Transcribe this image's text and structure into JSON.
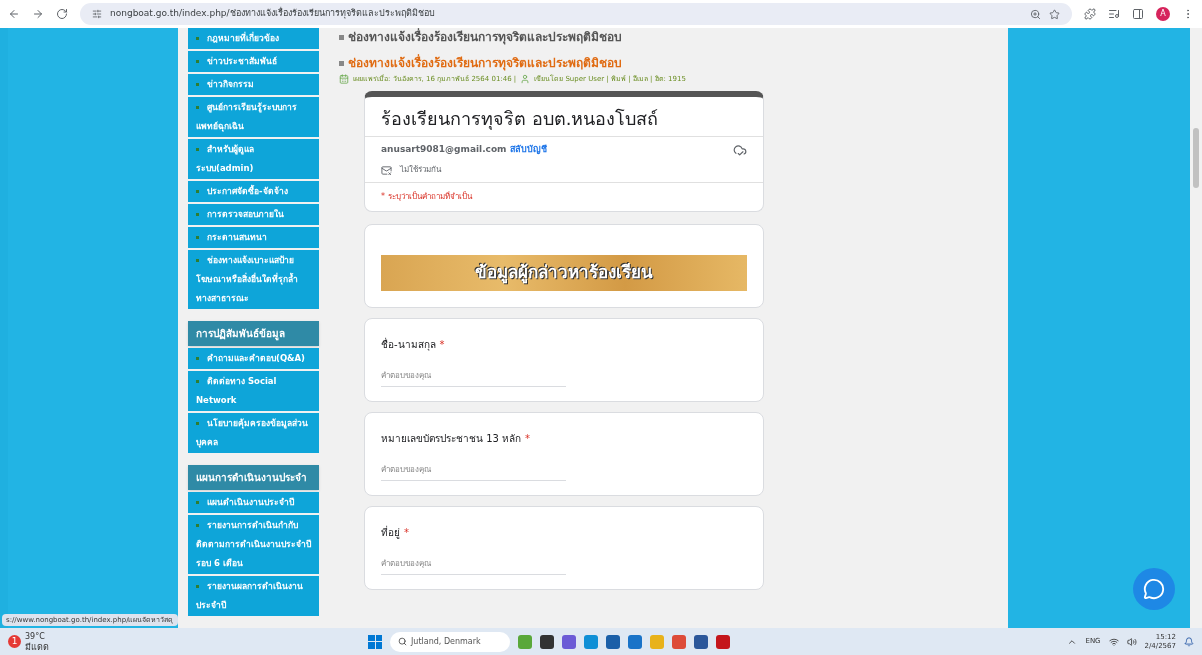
{
  "browser": {
    "url": "nongboat.go.th/index.php/ช่องทางแจ้งเรื่องร้องเรียนการทุจริตและประพฤติมิชอบ",
    "profile": "A"
  },
  "sidebar": {
    "items": [
      {
        "label": "กฎหมายที่เกี่ยวข้อง"
      },
      {
        "label": "ข่าวประชาสัมพันธ์"
      },
      {
        "label": "ข่าวกิจกรรม"
      },
      {
        "label": "ศูนย์การเรียนรู้ระบบการแพทย์ฉุกเฉิน"
      },
      {
        "label": "สำหรับผู้ดูแลระบบ(admin)"
      },
      {
        "label": "ประกาศจัดซื้อ-จัดจ้าง"
      },
      {
        "label": "การตรวจสอบภายใน"
      },
      {
        "label": "กระดานสนทนา"
      },
      {
        "label": "ช่องทางแจ้งเบาะแสป้ายโฆษณาหรือสิ่งอื่นใดที่รุกล้ำทางสาธารณะ"
      }
    ],
    "sections": [
      {
        "heading": "การปฏิสัมพันธ์ข้อมูล",
        "items": [
          {
            "label": "คำถามและคำตอบ(Q&A)"
          },
          {
            "label": "ติดต่อทาง Social Network"
          },
          {
            "label": "นโยบายคุ้มครองข้อมูลส่วนบุคคล"
          }
        ]
      },
      {
        "heading": "แผนการดำเนินงานประจำ",
        "items": [
          {
            "label": "แผนดำเนินงานประจำปี"
          },
          {
            "label": "รายงานการดำเนินกำกับติดตามการดำเนินงานประจำปี รอบ 6 เดือน"
          },
          {
            "label": "รายงานผลการดำเนินงานประจำปี"
          }
        ]
      }
    ]
  },
  "article": {
    "prev_title": "ช่องทางแจ้งเรื่องร้องเรียนการทุจริตและประพฤติมิชอบ",
    "title": "ช่องทางแจ้งเรื่องร้องเรียนการทุจริตและประพฤติมิชอบ",
    "published": "เผยแพร่เมื่อ: วันอังคาร, 16 กุมภาพันธ์ 2564 01:46 |",
    "meta": "เขียนโดย Super User | พิมพ์ | อีเมล | ฮิต: 1915"
  },
  "form": {
    "required_mark": "*",
    "title": "ร้องเรียนการทุจริต อบต.หนองโบสถ์",
    "email": "anusart9081@gmail.com",
    "switch_account": "สลับบัญชี",
    "not_shared": "ไม่ใช้ร่วมกัน",
    "required_note": "* ระบุว่าเป็นคำถามที่จำเป็น",
    "banner": "ข้อมูลผู้กล่าวหาร้องเรียน",
    "questions": [
      {
        "label": "ชื่อ-นามสกุล",
        "required": true,
        "placeholder": "คำตอบของคุณ"
      },
      {
        "label": "หมายเลขบัตรประชาชน 13 หลัก",
        "required": true,
        "placeholder": "คำตอบของคุณ"
      },
      {
        "label": "ที่อยู่",
        "required": true,
        "placeholder": "คำตอบของคุณ"
      }
    ]
  },
  "status_url": "s://www.nongboat.go.th/index.php/แผนจัดหาวัสดุ",
  "taskbar": {
    "weather_badge": "1",
    "temperature": "39°C",
    "weather": "มีแดด",
    "search": "Jutland, Denmark",
    "language": "ENG",
    "time": "15:12",
    "date": "2/4/2567"
  }
}
